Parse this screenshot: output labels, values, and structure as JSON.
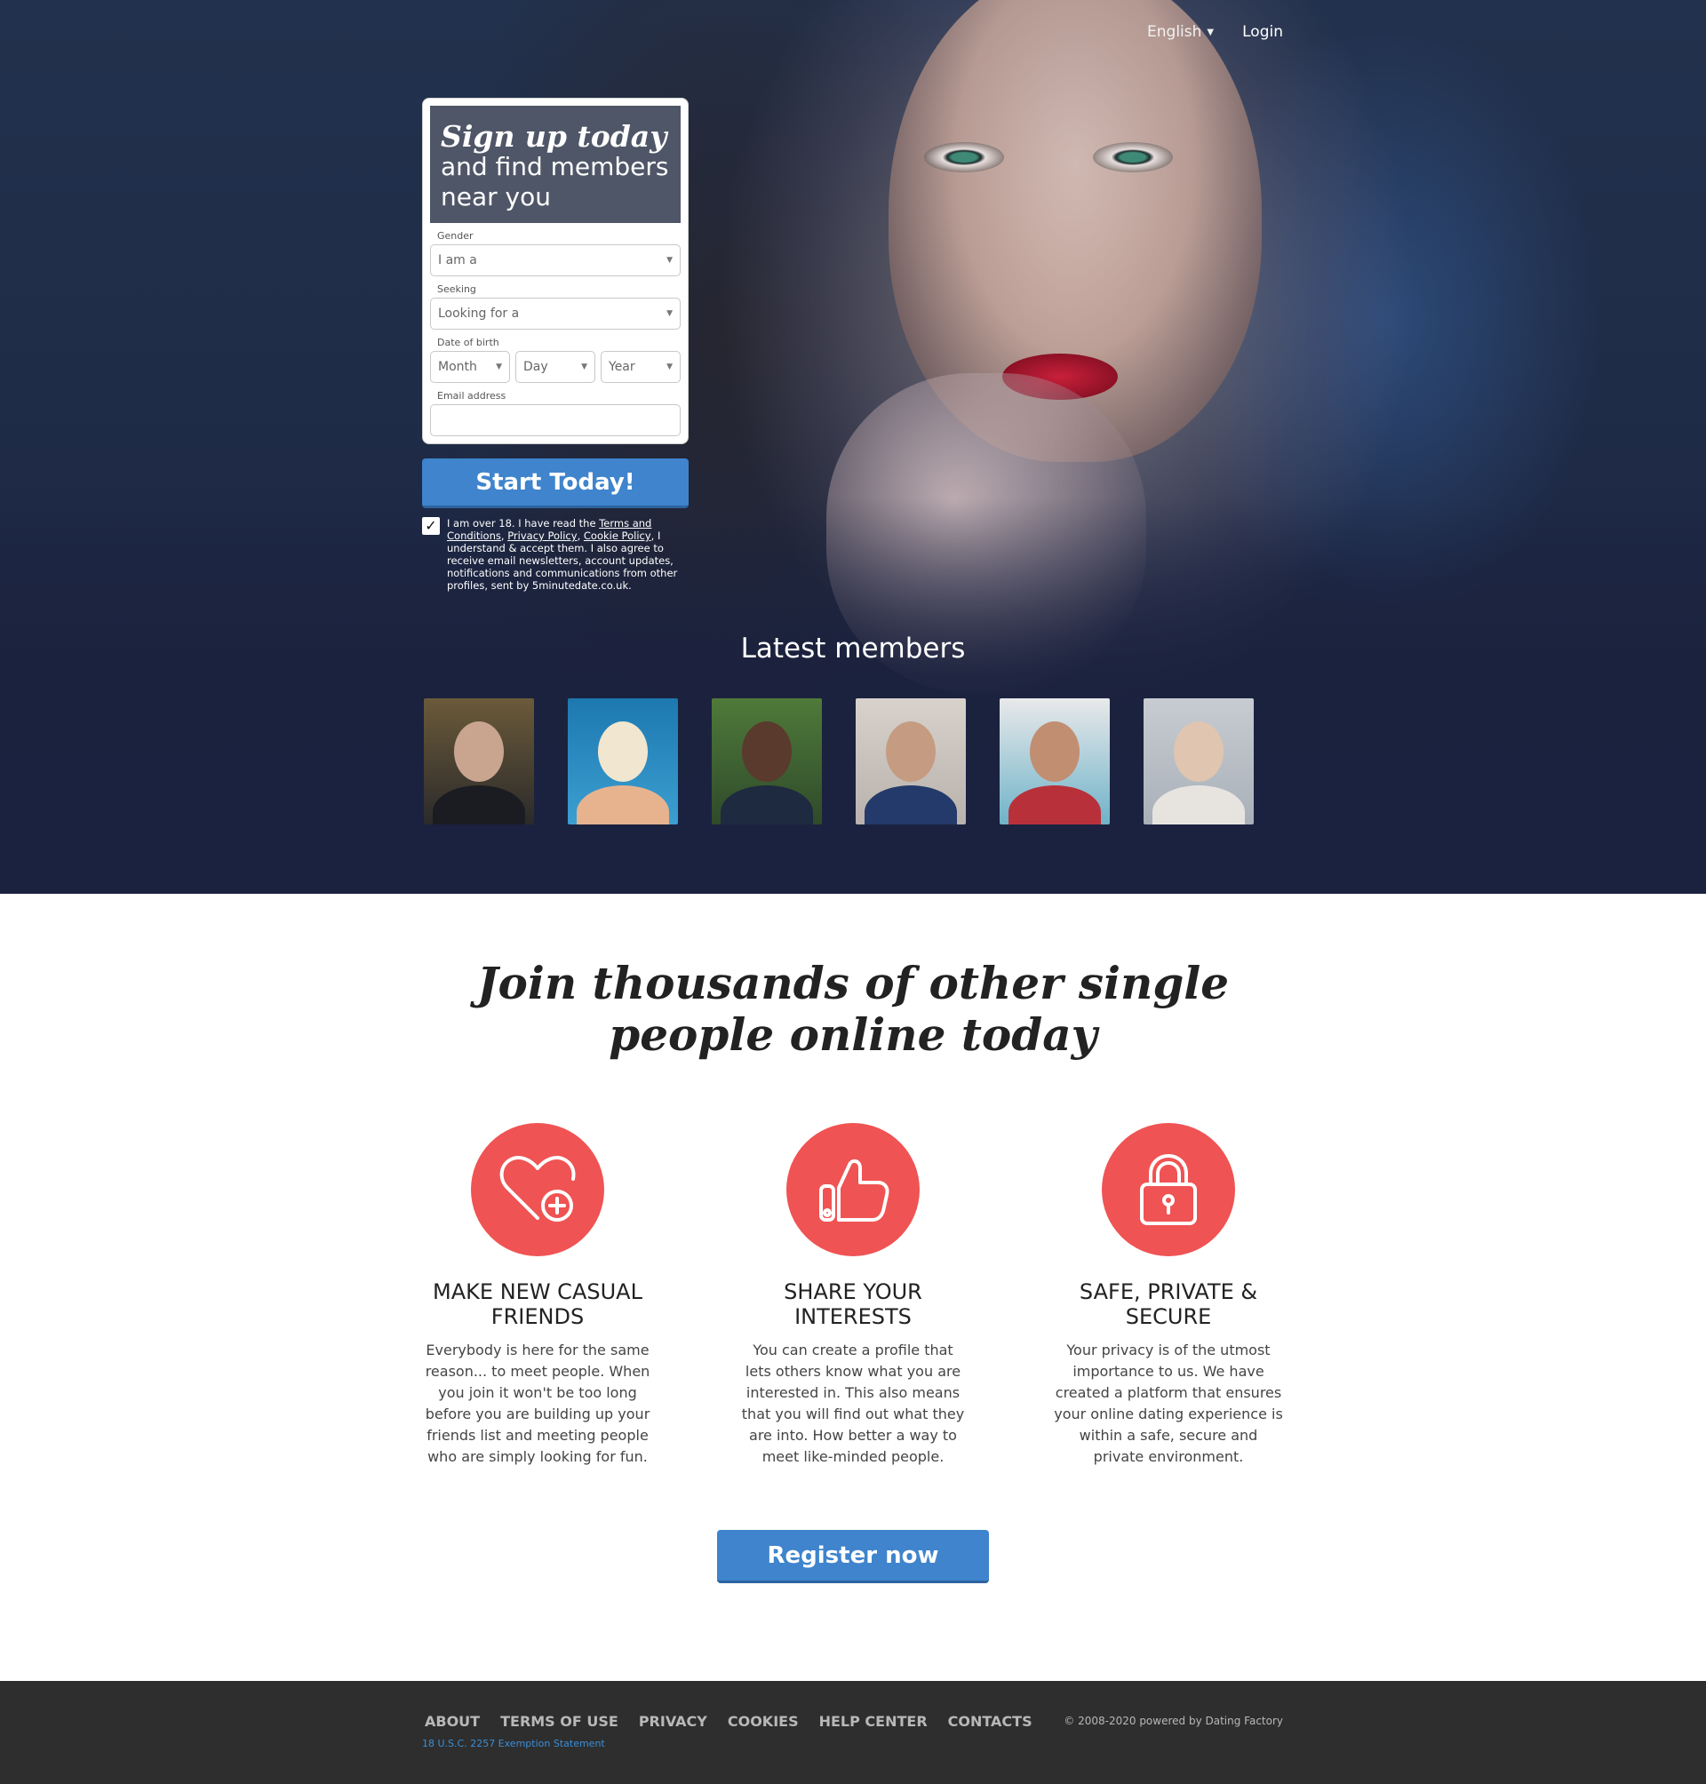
{
  "nav": {
    "language": "English",
    "login": "Login"
  },
  "signup": {
    "title": "Sign up today",
    "subtitle": "and find members near you",
    "gender_label": "Gender",
    "gender_value": "I am a",
    "seeking_label": "Seeking",
    "seeking_value": "Looking for a",
    "dob_label": "Date of birth",
    "month": "Month",
    "day": "Day",
    "year": "Year",
    "email_label": "Email address",
    "email_value": "",
    "start_button": "Start Today!",
    "terms_before": "I am over 18. I have read the ",
    "terms_link": "Terms and Conditions",
    "terms_sep1": ", ",
    "privacy_link": "Privacy Policy",
    "terms_sep2": ", ",
    "cookie_link": "Cookie Policy",
    "terms_after": ", I understand & accept them. I also agree to receive email newsletters, account updates, notifications and communications from other profiles, sent by 5minutedate.co.uk."
  },
  "latest": {
    "title": "Latest members"
  },
  "join": {
    "title": "Join thousands of other single people online today"
  },
  "features": [
    {
      "icon": "heart-plus-icon",
      "title": "MAKE NEW CASUAL FRIENDS",
      "text": "Everybody is here for the same reason... to meet people. When you join it won't be too long before you are building up your friends list and meeting people who are simply looking for fun."
    },
    {
      "icon": "thumbs-up-icon",
      "title": "SHARE YOUR INTERESTS",
      "text": "You can create a profile that lets others know what you are interested in. This also means that you will find out what they are into. How better a way to meet like-minded people."
    },
    {
      "icon": "padlock-icon",
      "title": "SAFE, PRIVATE & SECURE",
      "text": "Your privacy is of the utmost importance to us. We have created a platform that ensures your online dating experience is within a safe, secure and private environment."
    }
  ],
  "register_button": "Register now",
  "footer": {
    "links": [
      "ABOUT",
      "TERMS OF USE",
      "PRIVACY",
      "COOKIES",
      "HELP CENTER",
      "CONTACTS"
    ],
    "exemption": "18 U.S.C. 2257 Exemption Statement",
    "copyright": "© 2008-2020 powered by Dating Factory"
  },
  "colors": {
    "accent_blue": "#3f84cc",
    "accent_red": "#f05353",
    "footer_bg": "#2e2e2e"
  }
}
